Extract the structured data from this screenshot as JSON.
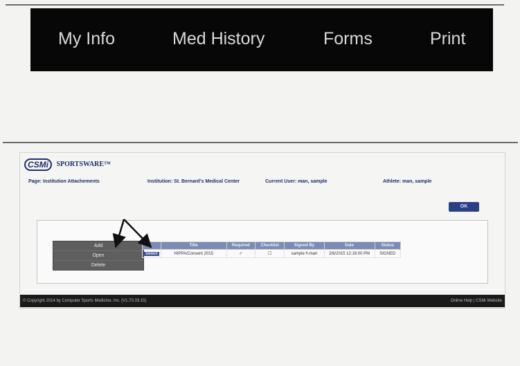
{
  "nav": {
    "items": [
      "My Info",
      "Med History",
      "Forms",
      "Print"
    ]
  },
  "app": {
    "logo_mark": "CSMi",
    "logo_text": "SPORTSWARE™",
    "info": {
      "page": "Page: Institution Attachements",
      "institution": "Institution: St. Bernard's Medical Center",
      "current_user": "Current User: man, sample",
      "athlete": "Athlete: man, sample"
    },
    "ok_label": "OK",
    "context_menu": [
      "Add",
      "Open",
      "Delete"
    ],
    "table": {
      "headers": [
        "",
        "Title",
        "Required",
        "Checklist",
        "Signed By",
        "Date",
        "Status"
      ],
      "row": {
        "select": "Select",
        "title": "HIPPA/Consent 2015",
        "required": "✓",
        "checklist": "☐",
        "signed_by": "sample h-man",
        "date": "2/6/2015 12:18:00 PM",
        "status": "SIGNED"
      }
    },
    "footer": {
      "copyright": "© Copyright 2014 by Computer Sports Medicine, Inc. (V1.70.33.15)",
      "links": "Online Help  |  CSMi Website"
    }
  },
  "colors": {
    "nav_bg": "#070707",
    "nav_text": "#d9d9d9",
    "brand_blue": "#1e2f6e",
    "table_header": "#7d8ab3",
    "footer_bg": "#1a1a1a"
  }
}
